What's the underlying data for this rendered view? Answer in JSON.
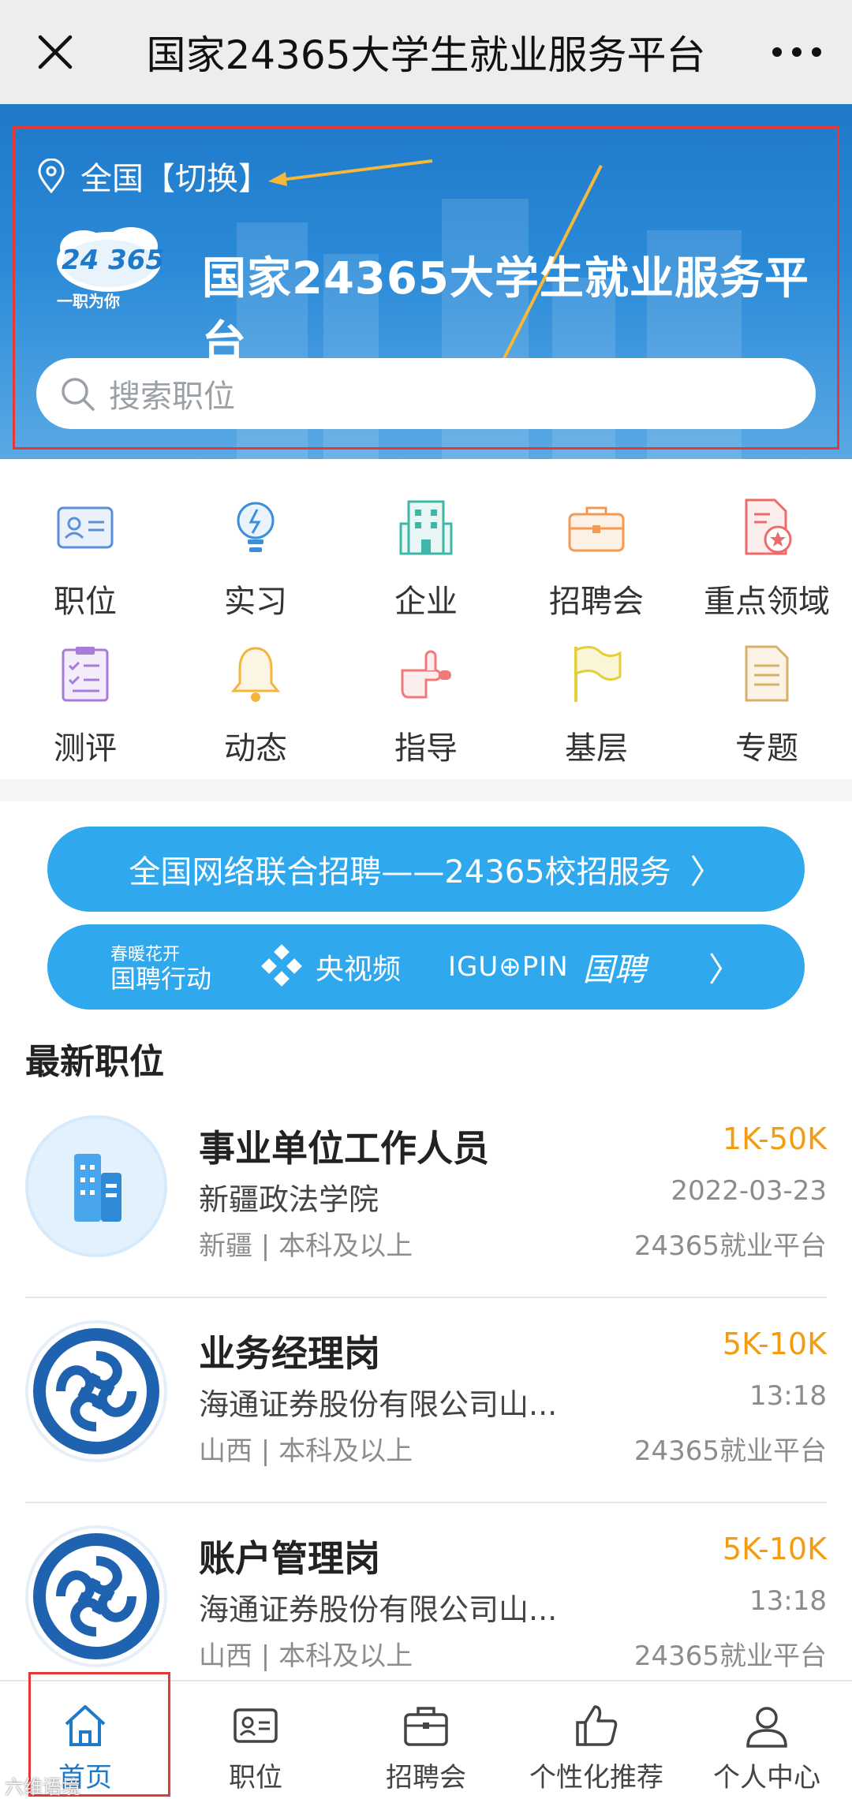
{
  "topbar": {
    "title": "国家24365大学生就业服务平台",
    "close_icon": "close-icon",
    "more_icon": "more-icon"
  },
  "hero": {
    "location": "全国【切换】",
    "logo_text": "24 365",
    "logo_sub": "一职为你",
    "title": "国家24365大学生就业服务平台",
    "search_placeholder": "搜索职位"
  },
  "grid": [
    {
      "label": "职位",
      "icon": "id-card-icon",
      "color": "#5b8fd8"
    },
    {
      "label": "实习",
      "icon": "lightbulb-icon",
      "color": "#3b8edc"
    },
    {
      "label": "企业",
      "icon": "building-icon",
      "color": "#3fb6a8"
    },
    {
      "label": "招聘会",
      "icon": "briefcase-icon",
      "color": "#f29a53"
    },
    {
      "label": "重点领域",
      "icon": "file-star-icon",
      "color": "#ee6b6b"
    },
    {
      "label": "测评",
      "icon": "checklist-icon",
      "color": "#a87bd8"
    },
    {
      "label": "动态",
      "icon": "bell-icon",
      "color": "#f3b63a"
    },
    {
      "label": "指导",
      "icon": "hand-point-icon",
      "color": "#f07a7a"
    },
    {
      "label": "基层",
      "icon": "flag-icon",
      "color": "#e4cf3a"
    },
    {
      "label": "专题",
      "icon": "document-icon",
      "color": "#d7b06a"
    }
  ],
  "banner1": {
    "text": "全国网络联合招聘——24365校招服务"
  },
  "banner2": {
    "brand1_line1": "春暖花开",
    "brand1_line2": "国聘行动",
    "brand2": "央视频",
    "brand3": "IGU⊕PIN",
    "brand4": "国聘"
  },
  "section_title": "最新职位",
  "jobs": [
    {
      "title": "事业单位工作人员",
      "company": "新疆政法学院",
      "meta": "新疆 | 本科及以上",
      "salary": "1K-50K",
      "date": "2022-03-23",
      "source": "24365就业平台",
      "logo": "building-logo"
    },
    {
      "title": "业务经理岗",
      "company": "海通证券股份有限公司山...",
      "meta": "山西 | 本科及以上",
      "salary": "5K-10K",
      "date": "13:18",
      "source": "24365就业平台",
      "logo": "haitong-logo"
    },
    {
      "title": "账户管理岗",
      "company": "海通证券股份有限公司山...",
      "meta": "山西 | 本科及以上",
      "salary": "5K-10K",
      "date": "13:18",
      "source": "24365就业平台",
      "logo": "haitong-logo"
    }
  ],
  "tabs": [
    {
      "label": "首页",
      "icon": "home-icon",
      "active": true
    },
    {
      "label": "职位",
      "icon": "id-card-icon"
    },
    {
      "label": "招聘会",
      "icon": "briefcase-icon"
    },
    {
      "label": "个性化推荐",
      "icon": "thumbs-up-icon"
    },
    {
      "label": "个人中心",
      "icon": "user-icon"
    }
  ],
  "watermark": "六维语境",
  "accent_color": "#1f79c9",
  "salary_color": "#f39c12"
}
